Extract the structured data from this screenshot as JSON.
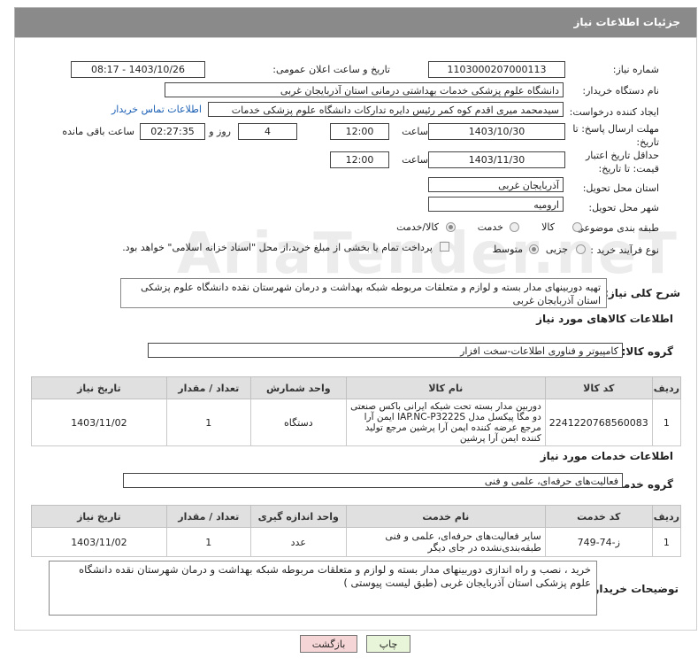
{
  "header": {
    "title": "جزئیات اطلاعات نیاز"
  },
  "fields": {
    "need_number_label": "شماره نیاز:",
    "need_number": "1103000207000113",
    "announce_label": "تاریخ و ساعت اعلان عمومی:",
    "announce_value": "1403/10/26 - 08:17",
    "buyer_org_label": "نام دستگاه خریدار:",
    "buyer_org": "دانشگاه علوم پزشکی خدمات بهداشتی درمانی استان آذربایجان غربی",
    "requester_label": "ایجاد کننده درخواست:",
    "requester": "سیدمحمد میری اقدم کوه کمر رئیس دایره تدارکات دانشگاه علوم پزشکی خدمات",
    "buyer_contact_link": "اطلاعات تماس خریدار",
    "deadline_label": "مهلت ارسال پاسخ: تا تاریخ:",
    "deadline_date": "1403/10/30",
    "time_label": "ساعت",
    "deadline_time": "12:00",
    "days_value": "4",
    "days_label": "روز و",
    "remaining_time": "02:27:35",
    "remaining_label": "ساعت باقی مانده",
    "validity_label": "حداقل تاریخ اعتبار قیمت: تا تاریخ:",
    "validity_date": "1403/11/30",
    "validity_time_label": "ساعت",
    "validity_time": "12:00",
    "province_label": "استان محل تحویل:",
    "province": "آذربایجان غربی",
    "city_label": "شهر محل تحویل:",
    "city": "ارومیه",
    "category_label": "طبقه بندی موضوعی:",
    "category_options": [
      "کالا",
      "خدمت",
      "کالا/خدمت"
    ],
    "purchase_type_label": "نوع فرآیند خرید :",
    "purchase_options": [
      "جزیی",
      "متوسط"
    ],
    "payment_note": "پرداخت تمام یا بخشی از مبلغ خرید،از محل \"اسناد خزانه اسلامی\" خواهد بود.",
    "summary_label": "شرح کلی نیاز:",
    "summary_text": "تهیه  دوربینهای مدار بسته و لوازم و متعلقات مربوطه  شبکه بهداشت و درمان شهرستان نقده دانشگاه علوم پزشکی استان آذربایجان غربی"
  },
  "goods": {
    "section_title": "اطلاعات کالاهای مورد نیاز",
    "group_label": "گروه کالا:",
    "group_value": "کامپیوتر و فناوری اطلاعات-سخت افزار",
    "columns": [
      "ردیف",
      "کد کالا",
      "نام کالا",
      "واحد شمارش",
      "تعداد / مقدار",
      "تاریخ نیاز"
    ],
    "rows": [
      {
        "index": "1",
        "code": "2241220768560083",
        "name": "دوربین مدار بسته تحت شبکه ایرانی باکس صنعتی دو مگا پیکسل مدل IAP.NC-P3222S ایمن آرا مرجع عرضه کننده ایمن آرا پرشین مرجع تولید کننده ایمن آرا پرشین",
        "unit": "دستگاه",
        "qty": "1",
        "date": "1403/11/02"
      }
    ]
  },
  "services": {
    "section_title": "اطلاعات خدمات مورد نیاز",
    "group_label": "گروه خدمت:",
    "group_value": "فعالیت‌های حرفه‌ای، علمی و فنی",
    "columns": [
      "ردیف",
      "کد خدمت",
      "نام خدمت",
      "واحد اندازه گیری",
      "تعداد / مقدار",
      "تاریخ نیاز"
    ],
    "rows": [
      {
        "index": "1",
        "code": "ز-74-749",
        "name": "سایر فعالیت‌های حرفه‌ای، علمی و فنی طبقه‌بندی‌نشده در جای دیگر",
        "unit": "عدد",
        "qty": "1",
        "date": "1403/11/02"
      }
    ]
  },
  "buyer_notes": {
    "label": "توضیحات خریدار:",
    "text": "خرید ، نصب و راه اندازی  دوربینهای مدار بسته و لوازم و متعلقات مربوطه  شبکه بهداشت و درمان شهرستان نقده دانشگاه علوم پزشکی استان آذربایجان غربی (طبق لیست پیوستی )"
  },
  "buttons": {
    "print": "چاپ",
    "back": "بازگشت"
  },
  "watermark": "AriaTender.neT",
  "colors": {
    "header_bg": "#8a8a8a",
    "link": "#1a5fb4",
    "back_button": "#f5d5d5",
    "print_button": "#e8f5d8"
  }
}
